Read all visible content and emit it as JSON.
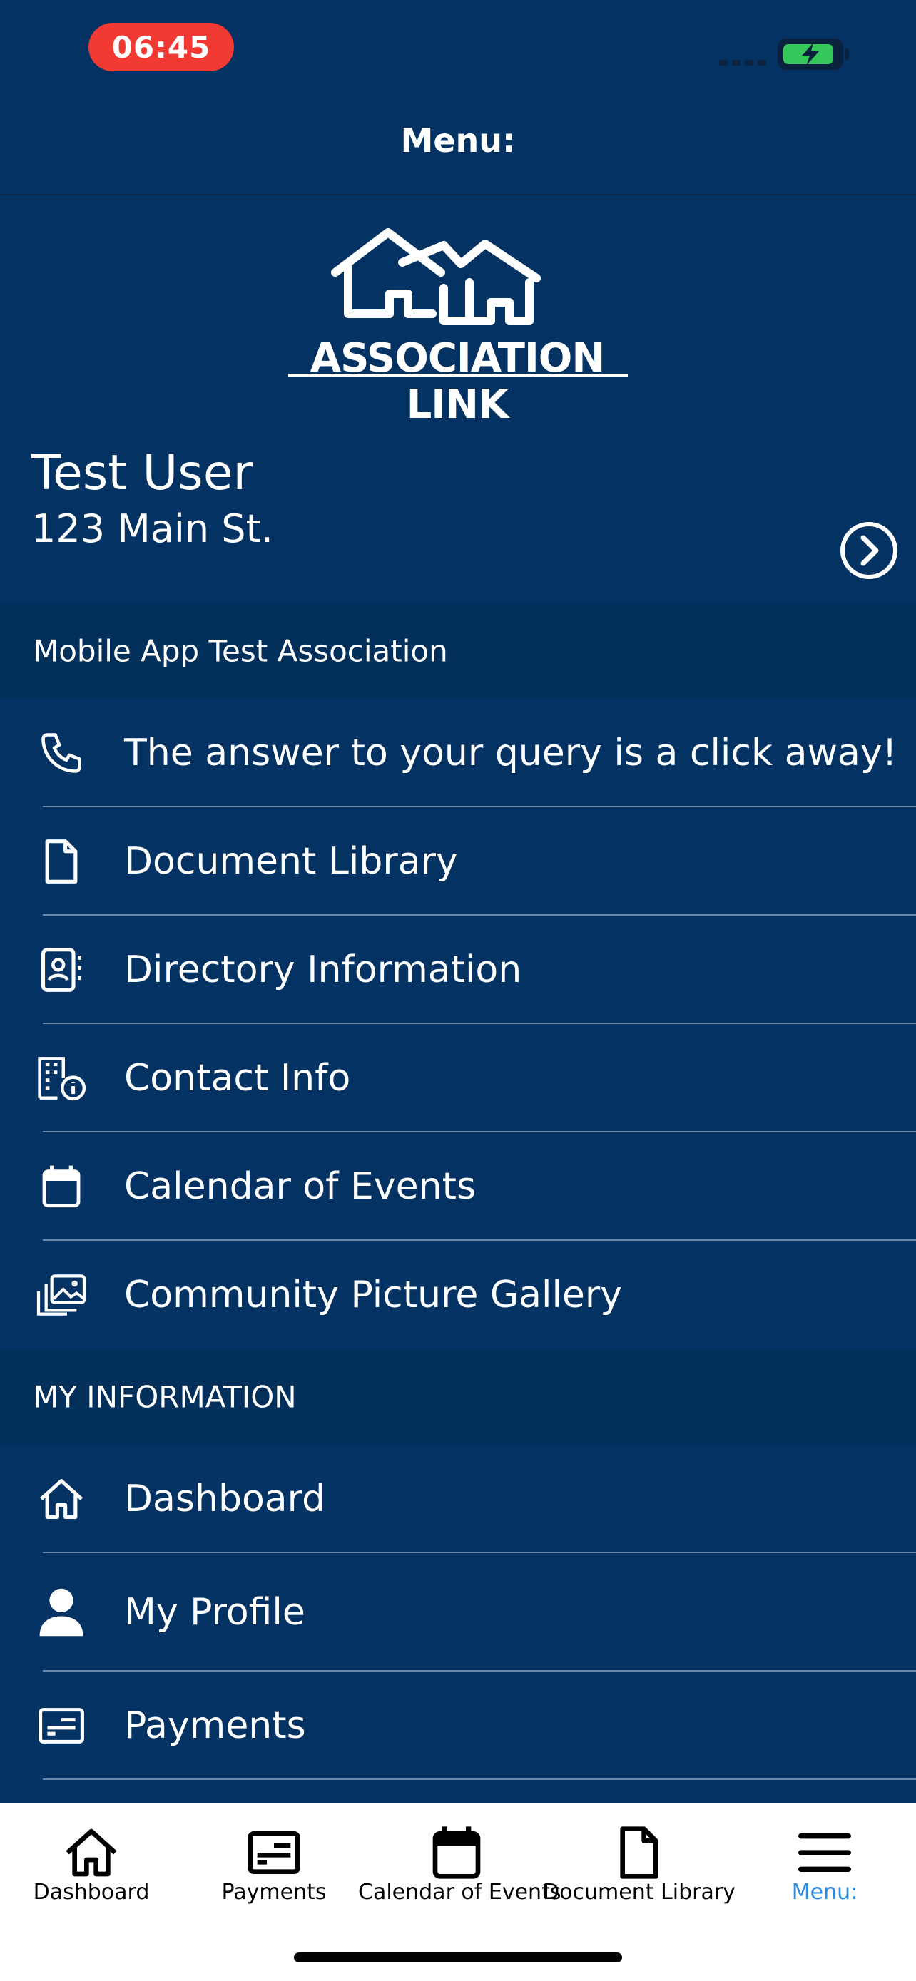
{
  "status_bar": {
    "time": "06:45"
  },
  "header": {
    "title": "Menu:"
  },
  "logo": {
    "text": "ASSOCIATION LINK"
  },
  "user": {
    "name": "Test User",
    "address": "123 Main St."
  },
  "association_section": {
    "title": "Mobile App Test Association",
    "items": [
      {
        "label": "The answer to your query is a click away!",
        "icon": "phone-icon"
      },
      {
        "label": "Document Library",
        "icon": "document-icon"
      },
      {
        "label": "Directory Information",
        "icon": "contact-card-icon"
      },
      {
        "label": "Contact Info",
        "icon": "building-info-icon"
      },
      {
        "label": "Calendar of Events",
        "icon": "calendar-icon"
      },
      {
        "label": "Community Picture Gallery",
        "icon": "gallery-icon"
      }
    ]
  },
  "my_info_section": {
    "title": "MY INFORMATION",
    "items": [
      {
        "label": "Dashboard",
        "icon": "home-icon"
      },
      {
        "label": "My Profile",
        "icon": "person-icon"
      },
      {
        "label": "Payments",
        "icon": "payment-card-icon"
      }
    ]
  },
  "tab_bar": {
    "tabs": [
      {
        "label": "Dashboard",
        "icon": "home-icon",
        "active": false
      },
      {
        "label": "Payments",
        "icon": "payment-card-icon",
        "active": false
      },
      {
        "label": "Calendar of Events",
        "icon": "calendar-icon",
        "active": false
      },
      {
        "label": "Document Library",
        "icon": "document-icon",
        "active": false
      },
      {
        "label": "Menu:",
        "icon": "menu-icon",
        "active": true
      }
    ]
  },
  "colors": {
    "background": "#043363",
    "section_header": "#03305a",
    "active_tab": "#2d8ae0",
    "time_pill": "#f03a33"
  }
}
